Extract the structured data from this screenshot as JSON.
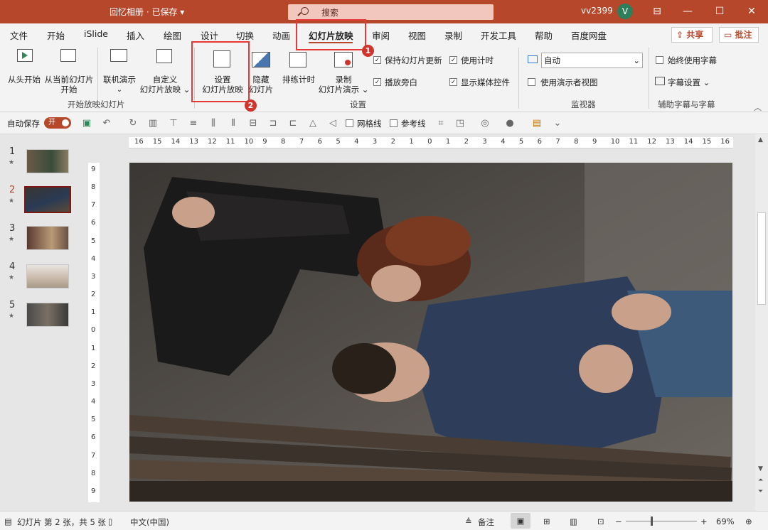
{
  "titlebar": {
    "doc_title": "回忆相册 · 已保存 ▾",
    "search_label": "搜索",
    "user_name": "vv2399",
    "avatar_letter": "V",
    "brand_color": "#b7472a"
  },
  "tabs": [
    "文件",
    "开始",
    "iSlide",
    "插入",
    "绘图",
    "设计",
    "切换",
    "动画",
    "幻灯片放映",
    "审阅",
    "视图",
    "录制",
    "开发工具",
    "帮助",
    "百度网盘"
  ],
  "share_label": "共享",
  "comment_label": "批注",
  "ribbon": {
    "group1_label": "开始放映幻灯片",
    "group2_label": "设置",
    "group3_label": "监视器",
    "group4_label": "辅助字幕与字幕",
    "from_start": "从头开始",
    "from_current_1": "从当前幻灯片",
    "from_current_2": "开始",
    "online_present": "联机演示",
    "custom_show_1": "自定义",
    "custom_show_2": "幻灯片放映 ⌄",
    "setup_show_1": "设置",
    "setup_show_2": "幻灯片放映",
    "hide_slide_1": "隐藏",
    "hide_slide_2": "幻灯片",
    "rehearse": "排练计时",
    "record_1": "录制",
    "record_2": "幻灯片演示 ⌄",
    "keep_updated": "保持幻灯片更新",
    "play_narrations": "播放旁白",
    "use_timings": "使用计时",
    "show_media_controls": "显示媒体控件",
    "monitor_value": "自动",
    "use_presenter_view": "使用演示者视图",
    "always_subtitles": "始终使用字幕",
    "subtitle_settings": "字幕设置 ⌄"
  },
  "badges": [
    "1",
    "2"
  ],
  "qat": {
    "autosave_label": "自动保存",
    "autosave_state": "开",
    "gridlines": "网格线",
    "guides": "参考线"
  },
  "thumbnails": [
    "1",
    "2",
    "3",
    "4",
    "5"
  ],
  "selected_slide": "2",
  "hruler_ticks": [
    "16",
    "15",
    "14",
    "13",
    "12",
    "11",
    "10",
    "9",
    "8",
    "7",
    "6",
    "5",
    "4",
    "3",
    "2",
    "1",
    "0",
    "1",
    "2",
    "3",
    "4",
    "5",
    "6",
    "7",
    "8",
    "9",
    "10",
    "11",
    "12",
    "13",
    "14",
    "15",
    "16"
  ],
  "vruler_ticks": [
    "9",
    "8",
    "7",
    "6",
    "5",
    "4",
    "3",
    "2",
    "1",
    "0",
    "1",
    "2",
    "3",
    "4",
    "5",
    "6",
    "7",
    "8",
    "9"
  ],
  "status": {
    "slide_info": "幻灯片 第 2 张，共 5 张",
    "language": "中文(中国)",
    "notes": "备注",
    "zoom": "69%"
  }
}
